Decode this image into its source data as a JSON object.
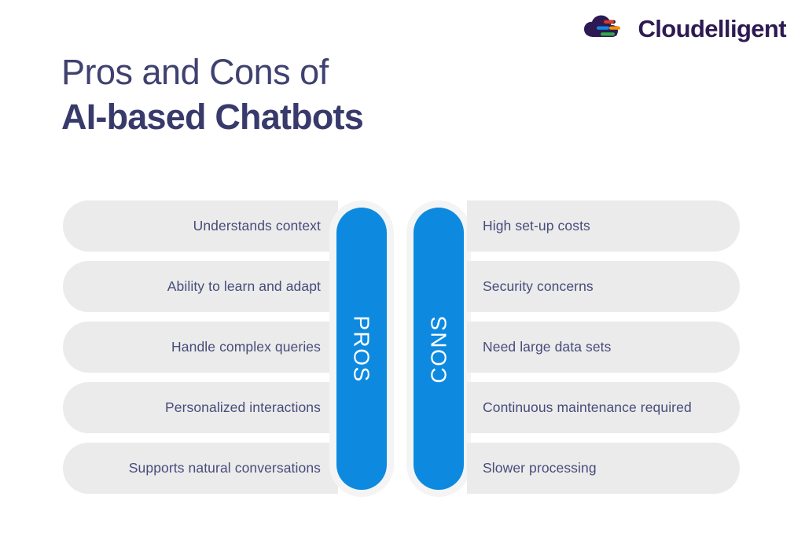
{
  "brand": {
    "name": "Cloudelligent",
    "logo_icon": "cloud-logo-icon",
    "wordmark_color": "#2e1a52",
    "cloud_color": "#2e1a52",
    "bar_colors": [
      "#d93a1e",
      "#1089e0",
      "#f59100",
      "#33a84e"
    ]
  },
  "headline": {
    "line1": "Pros and Cons of",
    "line2": "AI-based Chatbots",
    "color": "#383a6b"
  },
  "comparison": {
    "pros": {
      "label": "PROS",
      "accent_color": "#0d8ae0",
      "items": [
        "Understands context",
        "Ability to learn and adapt",
        "Handle complex queries",
        "Personalized interactions",
        "Supports natural conversations"
      ]
    },
    "cons": {
      "label": "CONS",
      "accent_color": "#0d8ae0",
      "items": [
        "High set-up costs",
        "Security concerns",
        "Need large data sets",
        "Continuous maintenance required",
        "Slower processing"
      ]
    },
    "pill_color": "#ebebeb",
    "pill_text_color": "#474c7a"
  }
}
